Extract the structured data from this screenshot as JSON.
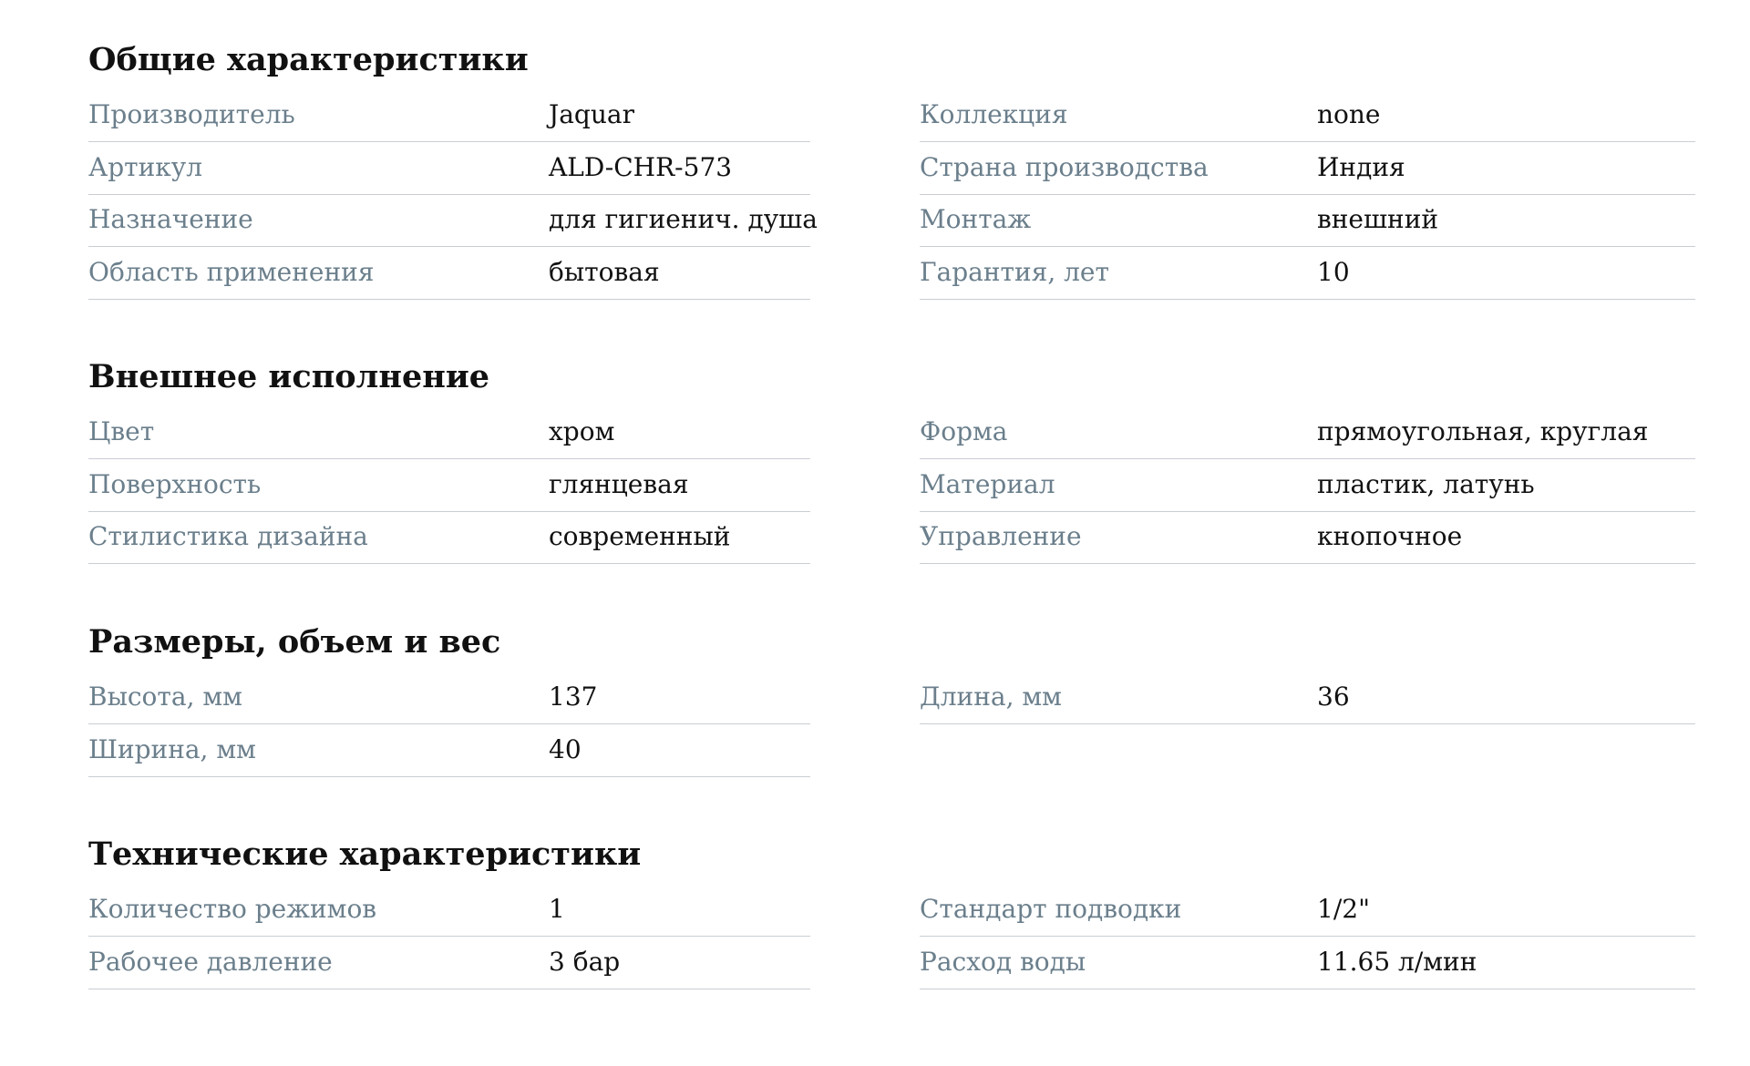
{
  "sections": [
    {
      "title": "Общие характеристики",
      "left": [
        {
          "label": "Производитель",
          "value": "Jaquar"
        },
        {
          "label": "Артикул",
          "value": "ALD-CHR-573"
        },
        {
          "label": "Назначение",
          "value": "для гигиенич. душа"
        },
        {
          "label": "Область применения",
          "value": "бытовая"
        }
      ],
      "right": [
        {
          "label": "Коллекция",
          "value": "none"
        },
        {
          "label": "Страна производства",
          "value": "Индия"
        },
        {
          "label": "Монтаж",
          "value": "внешний"
        },
        {
          "label": "Гарантия, лет",
          "value": "10"
        }
      ]
    },
    {
      "title": "Внешнее исполнение",
      "left": [
        {
          "label": "Цвет",
          "value": "хром"
        },
        {
          "label": "Поверхность",
          "value": "глянцевая"
        },
        {
          "label": "Стилистика дизайна",
          "value": "современный"
        }
      ],
      "right": [
        {
          "label": "Форма",
          "value": "прямоугольная, круглая"
        },
        {
          "label": "Материал",
          "value": "пластик, латунь"
        },
        {
          "label": "Управление",
          "value": "кнопочное"
        }
      ]
    },
    {
      "title": "Размеры, объем и вес",
      "left": [
        {
          "label": "Высота, мм",
          "value": "137"
        },
        {
          "label": "Ширина, мм",
          "value": "40"
        }
      ],
      "right": [
        {
          "label": "Длина, мм",
          "value": "36"
        }
      ]
    },
    {
      "title": "Технические характеристики",
      "left": [
        {
          "label": "Количество режимов",
          "value": "1"
        },
        {
          "label": "Рабочее давление",
          "value": "3 бар"
        }
      ],
      "right": [
        {
          "label": "Стандарт подводки",
          "value": "1/2\""
        },
        {
          "label": "Расход воды",
          "value": "11.65 л/мин"
        }
      ]
    }
  ]
}
